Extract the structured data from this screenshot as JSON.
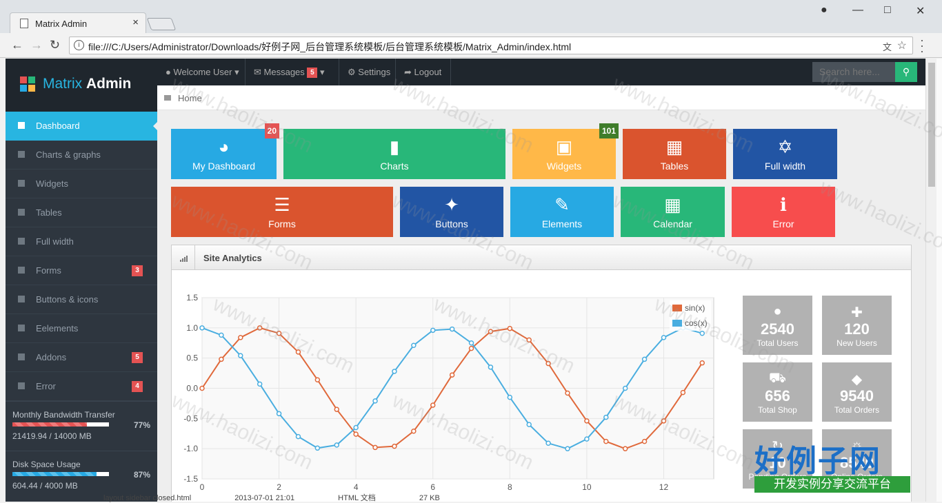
{
  "browser": {
    "tab_title": "Matrix Admin",
    "tab_close": "×",
    "url": "file:///C:/Users/Administrator/Downloads/好例子网_后台管理系统模板/后台管理系统模板/Matrix_Admin/index.html",
    "info_icon": "i",
    "window_controls": [
      "profile-icon",
      "minimize-icon",
      "maximize-icon",
      "close-icon"
    ]
  },
  "logo": {
    "text_light": "Matrix",
    "text_bold": "Admin"
  },
  "sidebar": {
    "items": [
      {
        "label": "Dashboard",
        "icon": "home-icon",
        "active": true,
        "badge": ""
      },
      {
        "label": "Charts & graphs",
        "icon": "signal-icon",
        "badge": ""
      },
      {
        "label": "Widgets",
        "icon": "inbox-icon",
        "badge": ""
      },
      {
        "label": "Tables",
        "icon": "th-icon",
        "badge": ""
      },
      {
        "label": "Full width",
        "icon": "fullscreen-icon",
        "badge": ""
      },
      {
        "label": "Forms",
        "icon": "list-icon",
        "badge": "3"
      },
      {
        "label": "Buttons & icons",
        "icon": "tint-icon",
        "badge": ""
      },
      {
        "label": "Eelements",
        "icon": "pencil-icon",
        "badge": ""
      },
      {
        "label": "Addons",
        "icon": "file-icon",
        "badge": "5"
      },
      {
        "label": "Error",
        "icon": "info-icon",
        "badge": "4"
      }
    ],
    "bandwidth": {
      "title": "Monthly Bandwidth Transfer",
      "value": "21419.94 / 14000 MB",
      "percent": "77%",
      "fraction": 0.77
    },
    "disk": {
      "title": "Disk Space Usage",
      "value": "604.44 / 4000 MB",
      "percent": "87%",
      "fraction": 0.87
    }
  },
  "topnav": {
    "welcome": "Welcome User",
    "messages": "Messages",
    "messages_count": "5",
    "settings": "Settings",
    "logout": "Logout",
    "search_placeholder": "Search here..."
  },
  "breadcrumb": {
    "home": "Home"
  },
  "tiles": [
    {
      "label": "My Dashboard",
      "color": "#27a9e3",
      "badge": "20",
      "badge_color": "#e45353",
      "icon": "dashboard-icon"
    },
    {
      "label": "Charts",
      "color": "#28b779",
      "badge": "",
      "icon": "signal-icon"
    },
    {
      "label": "Widgets",
      "color": "#ffb848",
      "badge": "101",
      "badge_color": "#3f7d2b",
      "icon": "inbox-icon"
    },
    {
      "label": "Tables",
      "color": "#da542e",
      "badge": "",
      "icon": "th-icon"
    },
    {
      "label": "Full width",
      "color": "#2255a4",
      "badge": "",
      "icon": "fullscreen-icon"
    },
    {
      "label": "Forms",
      "color": "#da542e",
      "badge": "",
      "icon": "list-icon"
    },
    {
      "label": "Buttons",
      "color": "#2255a4",
      "badge": "",
      "icon": "tint-icon"
    },
    {
      "label": "Elements",
      "color": "#27a9e3",
      "badge": "",
      "icon": "pencil-icon"
    },
    {
      "label": "Calendar",
      "color": "#28b779",
      "badge": "",
      "icon": "calendar-icon"
    },
    {
      "label": "Error",
      "color": "#f74d4d",
      "badge": "",
      "icon": "info-icon"
    }
  ],
  "analytics": {
    "title": "Site Analytics",
    "kpis": [
      {
        "value": "2540",
        "label": "Total Users",
        "icon": "user-icon"
      },
      {
        "value": "120",
        "label": "New Users",
        "icon": "plus-icon"
      },
      {
        "value": "656",
        "label": "Total Shop",
        "icon": "cart-icon"
      },
      {
        "value": "9540",
        "label": "Total Orders",
        "icon": "tag-icon"
      },
      {
        "value": "10",
        "label": "Pending Orders",
        "icon": "repeat-icon"
      },
      {
        "value": "8540",
        "label": "Online Orders",
        "icon": "globe-icon"
      }
    ]
  },
  "chart_data": {
    "type": "line",
    "title": "",
    "xlabel": "",
    "ylabel": "",
    "xlim": [
      0,
      13.3
    ],
    "ylim": [
      -1.5,
      1.5
    ],
    "xticks": [
      0,
      2,
      4,
      6,
      8,
      10,
      12
    ],
    "yticks": [
      -1.5,
      -1.0,
      -0.5,
      0.0,
      0.5,
      1.0,
      1.5
    ],
    "grid": true,
    "legend": "top-right",
    "x": [
      0,
      0.5,
      1,
      1.5,
      2,
      2.5,
      3,
      3.5,
      4,
      4.5,
      5,
      5.5,
      6,
      6.5,
      7,
      7.5,
      8,
      8.5,
      9,
      9.5,
      10,
      10.5,
      11,
      11.5,
      12,
      12.5,
      13
    ],
    "series": [
      {
        "name": "sin(x)",
        "color": "#e0693b",
        "values": [
          0.0,
          0.48,
          0.84,
          1.0,
          0.91,
          0.6,
          0.14,
          -0.35,
          -0.76,
          -0.98,
          -0.96,
          -0.71,
          -0.28,
          0.22,
          0.66,
          0.94,
          0.99,
          0.8,
          0.41,
          -0.08,
          -0.54,
          -0.88,
          -1.0,
          -0.88,
          -0.54,
          -0.07,
          0.42
        ]
      },
      {
        "name": "cos(x)",
        "color": "#4aaee0",
        "values": [
          1.0,
          0.88,
          0.54,
          0.07,
          -0.42,
          -0.8,
          -0.99,
          -0.94,
          -0.65,
          -0.21,
          0.28,
          0.71,
          0.96,
          0.98,
          0.75,
          0.35,
          -0.15,
          -0.6,
          -0.91,
          -1.0,
          -0.84,
          -0.48,
          0.0,
          0.48,
          0.84,
          1.0,
          0.91
        ]
      }
    ]
  },
  "statusbar": {
    "file": "layout sidebar closed.html",
    "date": "2013-07-01 21:01",
    "type": "HTML 文档",
    "size": "27 KB"
  },
  "watermark": {
    "text": "www.haolizi.com",
    "brand_top": "好例子网",
    "brand_bottom": "开发实例分享交流平台"
  }
}
